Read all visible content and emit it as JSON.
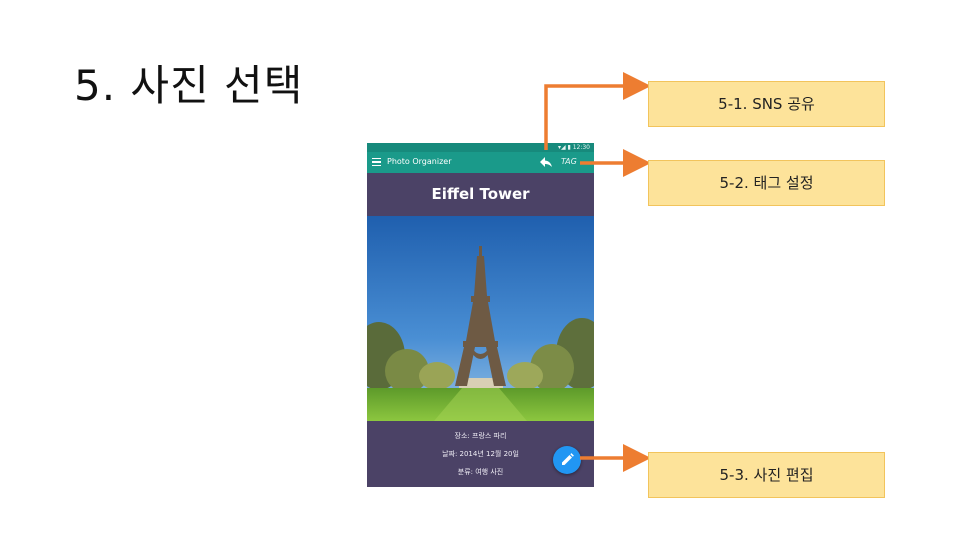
{
  "slide": {
    "title": "5. 사진 선택"
  },
  "app": {
    "status": "▾◢ ▮ 12:30",
    "name": "Photo Organizer",
    "tag_label": "TAG",
    "photo_title": "Eiffel Tower",
    "info": {
      "place": "장소: 프랑스 파리",
      "date": "날짜: 2014년 12월 20일",
      "category": "분류: 여행 사진"
    }
  },
  "callouts": {
    "share": "5-1. SNS 공유",
    "tag": "5-2. 태그 설정",
    "edit": "5-3. 사진 편집"
  },
  "colors": {
    "app_bar": "#1a9a8a",
    "status_bar": "#178a7c",
    "panel": "#4b4266",
    "fab": "#2196f3",
    "callout_fill": "#fde39a",
    "callout_border": "#f2c45c",
    "arrow": "#ed7d31"
  },
  "icons": [
    "menu-icon",
    "share-icon",
    "pencil-icon"
  ]
}
